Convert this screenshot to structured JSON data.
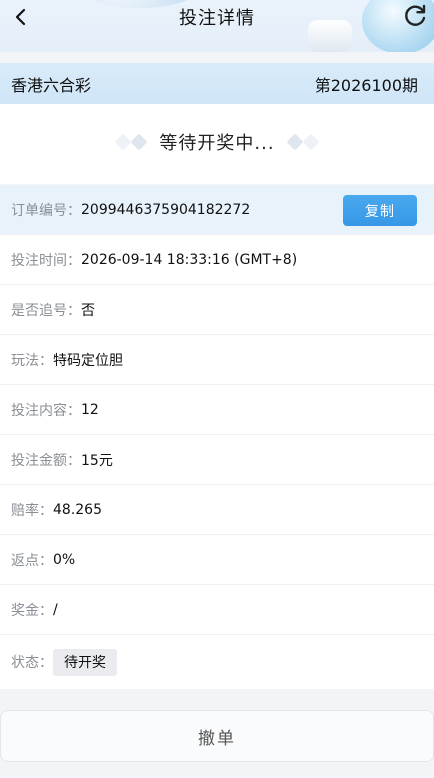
{
  "header": {
    "title": "投注详情",
    "back_icon": "chevron-left-icon",
    "refresh_icon": "refresh-icon"
  },
  "lottery": {
    "name": "香港六合彩",
    "period": "第2026100期"
  },
  "waiting": {
    "text": "等待开奖中..."
  },
  "order": {
    "number_label": "订单编号：",
    "number_value": "2099446375904182272",
    "copy_label": "复制",
    "time_label": "投注时间：",
    "time_value": "2026-09-14 18:33:16 (GMT+8)",
    "chase_label": "是否追号：",
    "chase_value": "否",
    "play_label": "玩法：",
    "play_value": "特码定位胆",
    "content_label": "投注内容：",
    "content_value": "12",
    "amount_label": "投注金额：",
    "amount_value": "15元",
    "odds_label": "赔率：",
    "odds_value": "48.265",
    "rebate_label": "返点：",
    "rebate_value": "0%",
    "prize_label": "奖金：",
    "prize_value": "/",
    "status_label": "状态：",
    "status_value": "待开奖"
  },
  "actions": {
    "cancel_label": "撤单"
  },
  "colors": {
    "accent": "#3698e6",
    "header_bg": "#e4eef8",
    "lottery_bar_bg": "#d8ebf9",
    "highlight_row_bg": "#e7f2fb",
    "label_gray": "#8a8f96"
  }
}
